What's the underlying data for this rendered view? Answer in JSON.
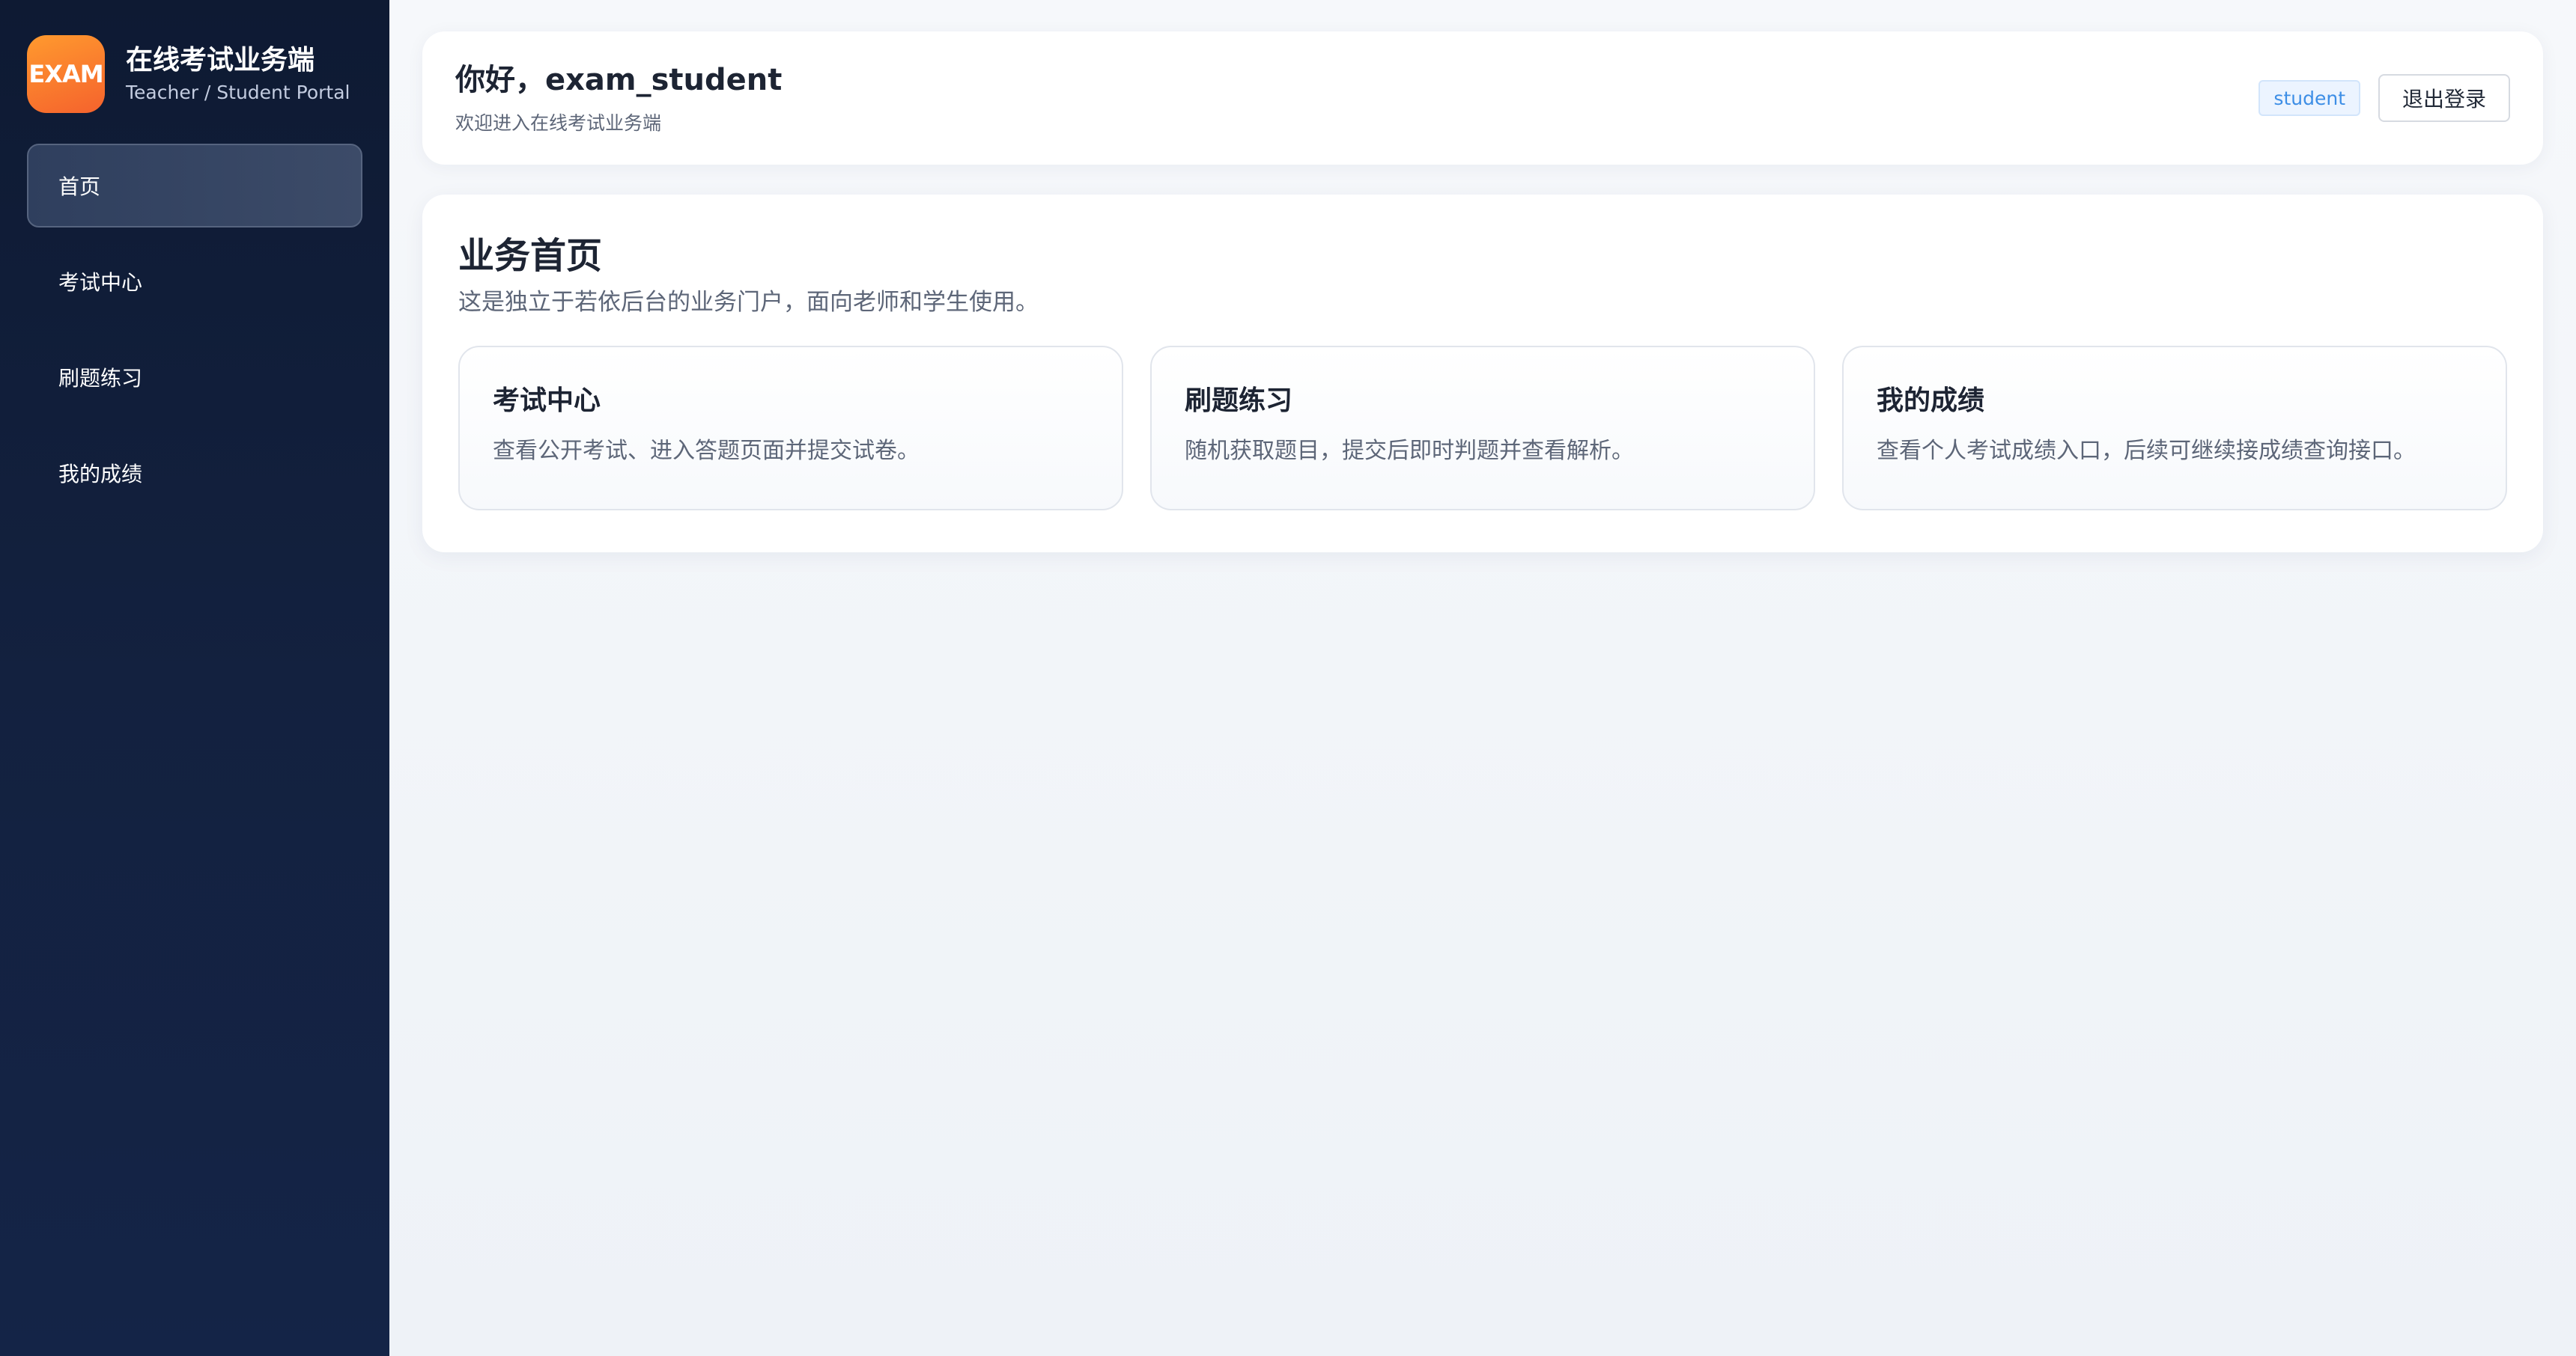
{
  "brand": {
    "logo_text": "EXAM",
    "title": "在线考试业务端",
    "subtitle": "Teacher / Student Portal"
  },
  "sidebar": {
    "items": [
      {
        "label": "首页",
        "active": true
      },
      {
        "label": "考试中心",
        "active": false
      },
      {
        "label": "刷题练习",
        "active": false
      },
      {
        "label": "我的成绩",
        "active": false
      }
    ]
  },
  "header": {
    "greeting": "你好，exam_student",
    "welcome": "欢迎进入在线考试业务端",
    "role_badge": "student",
    "logout_label": "退出登录"
  },
  "main": {
    "title": "业务首页",
    "description": "这是独立于若依后台的业务门户，面向老师和学生使用。",
    "tiles": [
      {
        "title": "考试中心",
        "description": "查看公开考试、进入答题页面并提交试卷。"
      },
      {
        "title": "刷题练习",
        "description": "随机获取题目，提交后即时判题并查看解析。"
      },
      {
        "title": "我的成绩",
        "description": "查看个人考试成绩入口，后续可继续接成绩查询接口。"
      }
    ]
  },
  "colors": {
    "sidebar_bg": "#0e1a33",
    "accent_orange": "#f5622d",
    "badge_blue": "#3d8ee6"
  }
}
